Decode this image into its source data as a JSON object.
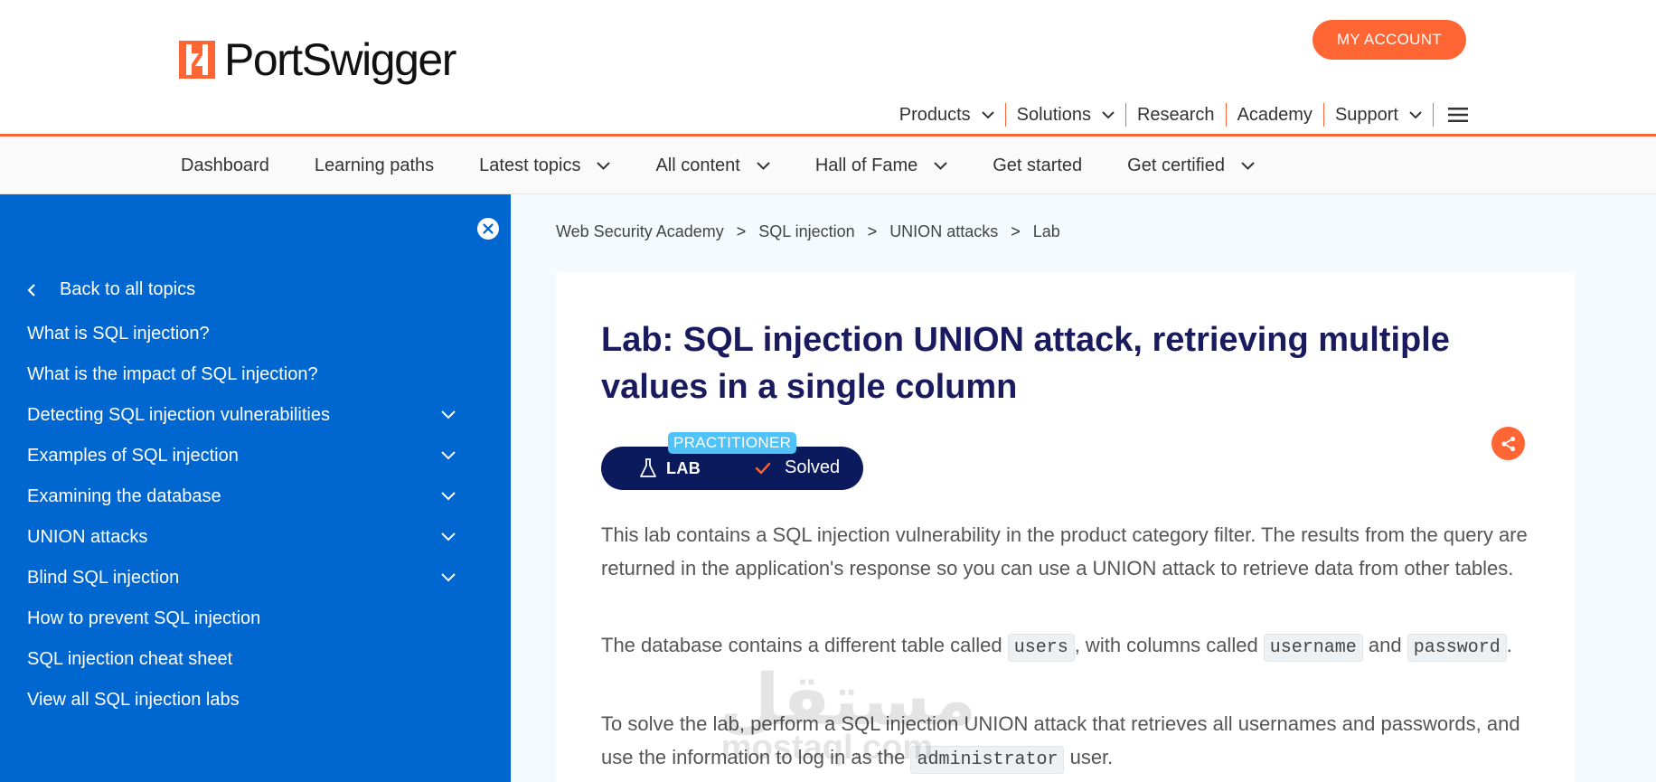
{
  "header": {
    "logo_text": "PortSwigger",
    "account_button": "MY ACCOUNT",
    "accent_color": "#ff6633",
    "nav": [
      {
        "label": "Products",
        "dropdown": true
      },
      {
        "label": "Solutions",
        "dropdown": true
      },
      {
        "label": "Research",
        "dropdown": false
      },
      {
        "label": "Academy",
        "dropdown": false
      },
      {
        "label": "Support",
        "dropdown": true
      }
    ],
    "menu_icon": "hamburger-menu-icon"
  },
  "sub_nav": {
    "items": [
      {
        "label": "Dashboard",
        "dropdown": false
      },
      {
        "label": "Learning paths",
        "dropdown": false
      },
      {
        "label": "Latest topics",
        "dropdown": true
      },
      {
        "label": "All content",
        "dropdown": true
      },
      {
        "label": "Hall of Fame",
        "dropdown": true
      },
      {
        "label": "Get started",
        "dropdown": false
      },
      {
        "label": "Get certified",
        "dropdown": true
      }
    ]
  },
  "sidebar": {
    "background": "#0066d0",
    "back_link": "Back to all topics",
    "items": [
      {
        "label": "What is SQL injection?",
        "expandable": false
      },
      {
        "label": "What is the impact of SQL injection?",
        "expandable": false
      },
      {
        "label": "Detecting SQL injection vulnerabilities",
        "expandable": true
      },
      {
        "label": "Examples of SQL injection",
        "expandable": true
      },
      {
        "label": "Examining the database",
        "expandable": true
      },
      {
        "label": "UNION attacks",
        "expandable": true
      },
      {
        "label": "Blind SQL injection",
        "expandable": true
      },
      {
        "label": "How to prevent SQL injection",
        "expandable": false
      },
      {
        "label": "SQL injection cheat sheet",
        "expandable": false
      },
      {
        "label": "View all SQL injection labs",
        "expandable": false
      }
    ]
  },
  "breadcrumb": {
    "items": [
      "Web Security Academy",
      "SQL injection",
      "UNION attacks",
      "Lab"
    ],
    "separator": ">"
  },
  "lab": {
    "title": "Lab: SQL injection UNION attack, retrieving multiple values in a single column",
    "level": "PRACTITIONER",
    "badge_label": "LAB",
    "status": "Solved",
    "para1": "This lab contains a SQL injection vulnerability in the product category filter. The results from the query are returned in the application's response so you can use a UNION attack to retrieve data from other tables.",
    "para2": {
      "t1": "The database contains a different table called ",
      "c1": "users",
      "t2": ", with columns called ",
      "c2": "username",
      "t3": " and ",
      "c3": "password",
      "t4": "."
    },
    "para3": {
      "t1": "To solve the lab, perform a SQL injection UNION attack that retrieves all usernames and passwords, and use the information to log in as the ",
      "c1": "administrator",
      "t2": " user."
    }
  },
  "watermark": {
    "arabic": "مستقل",
    "latin": "mostaql.com"
  }
}
